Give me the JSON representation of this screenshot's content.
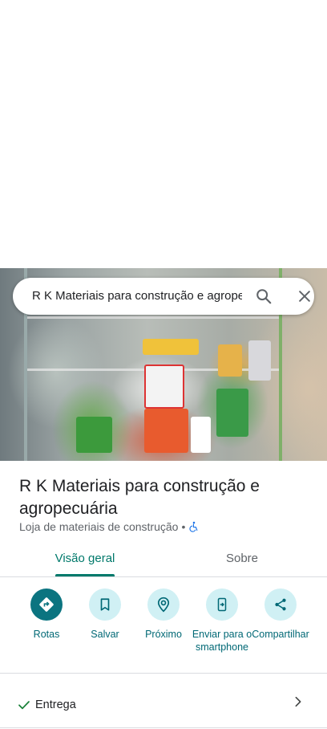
{
  "search": {
    "value": "R K Materiais para construção e agropecuária"
  },
  "place": {
    "title": "R K Materiais para construção e agropecuária",
    "category": "Loja de materiais de construção",
    "separator": "•"
  },
  "tabs": [
    {
      "label": "Visão geral",
      "active": true
    },
    {
      "label": "Sobre",
      "active": false
    }
  ],
  "actions": [
    {
      "label": "Rotas",
      "icon": "directions-icon"
    },
    {
      "label": "Salvar",
      "icon": "bookmark-icon"
    },
    {
      "label": "Próximo",
      "icon": "nearby-icon"
    },
    {
      "label": "Enviar para o smartphone",
      "icon": "send-to-phone-icon"
    },
    {
      "label": "Compartilhar",
      "icon": "share-icon"
    }
  ],
  "delivery": {
    "label": "Entrega"
  },
  "colors": {
    "accent": "#00796b",
    "primary_button": "#0b7480",
    "action_bg": "#d0f0f4",
    "check": "#188038"
  }
}
